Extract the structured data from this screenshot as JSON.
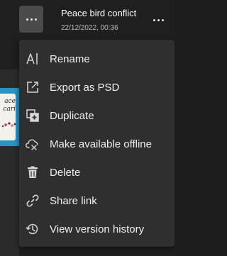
{
  "file": {
    "title": "Peace bird conflict",
    "timestamp": "22/12/2022, 00:36"
  },
  "thumbnail": {
    "text": "ace\ncari"
  },
  "menu": {
    "items": [
      {
        "label": "Rename",
        "icon": "rename-icon"
      },
      {
        "label": "Export as PSD",
        "icon": "export-icon"
      },
      {
        "label": "Duplicate",
        "icon": "duplicate-icon"
      },
      {
        "label": "Make available offline",
        "icon": "cloud-offline-icon"
      },
      {
        "label": "Delete",
        "icon": "trash-icon"
      },
      {
        "label": "Share link",
        "icon": "link-icon"
      },
      {
        "label": "View version history",
        "icon": "history-icon"
      }
    ]
  },
  "colors": {
    "background": "#1f1f1f",
    "menu": "#2f2f2f",
    "button_active": "#4a4a4a",
    "thumbnail_bg": "#2a94c4"
  }
}
